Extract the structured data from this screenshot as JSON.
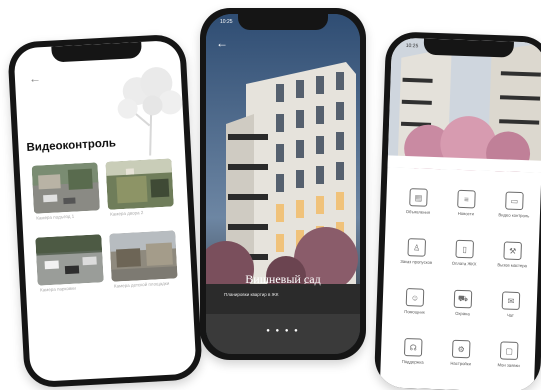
{
  "left_phone": {
    "title": "Видеоконтроль",
    "cameras": [
      {
        "label": "Камера подъезд 1"
      },
      {
        "label": "Камера двора 2"
      },
      {
        "label": "Камера парковки"
      },
      {
        "label": "Камера детской площадки"
      }
    ]
  },
  "middle_phone": {
    "status_time": "10:25",
    "title": "Вишневый сад",
    "subtitle": "Планировки квартир в ЖК"
  },
  "right_phone": {
    "status_time": "10:25",
    "tiles": [
      {
        "label": "Объявления",
        "icon": "document-icon"
      },
      {
        "label": "Новости",
        "icon": "newspaper-icon"
      },
      {
        "label": "Видео контроль",
        "icon": "camera-icon"
      },
      {
        "label": "Заказ пропусков",
        "icon": "person-icon"
      },
      {
        "label": "Оплата ЖКХ",
        "icon": "receipt-icon"
      },
      {
        "label": "Вызов мастера",
        "icon": "tools-icon"
      },
      {
        "label": "Помощник",
        "icon": "support-icon"
      },
      {
        "label": "Охрана",
        "icon": "car-icon"
      },
      {
        "label": "Чат",
        "icon": "chat-icon"
      },
      {
        "label": "Поддержка",
        "icon": "headset-icon"
      },
      {
        "label": "Настройки",
        "icon": "gear-icon"
      },
      {
        "label": "Мои заявки",
        "icon": "clipboard-icon"
      }
    ]
  }
}
